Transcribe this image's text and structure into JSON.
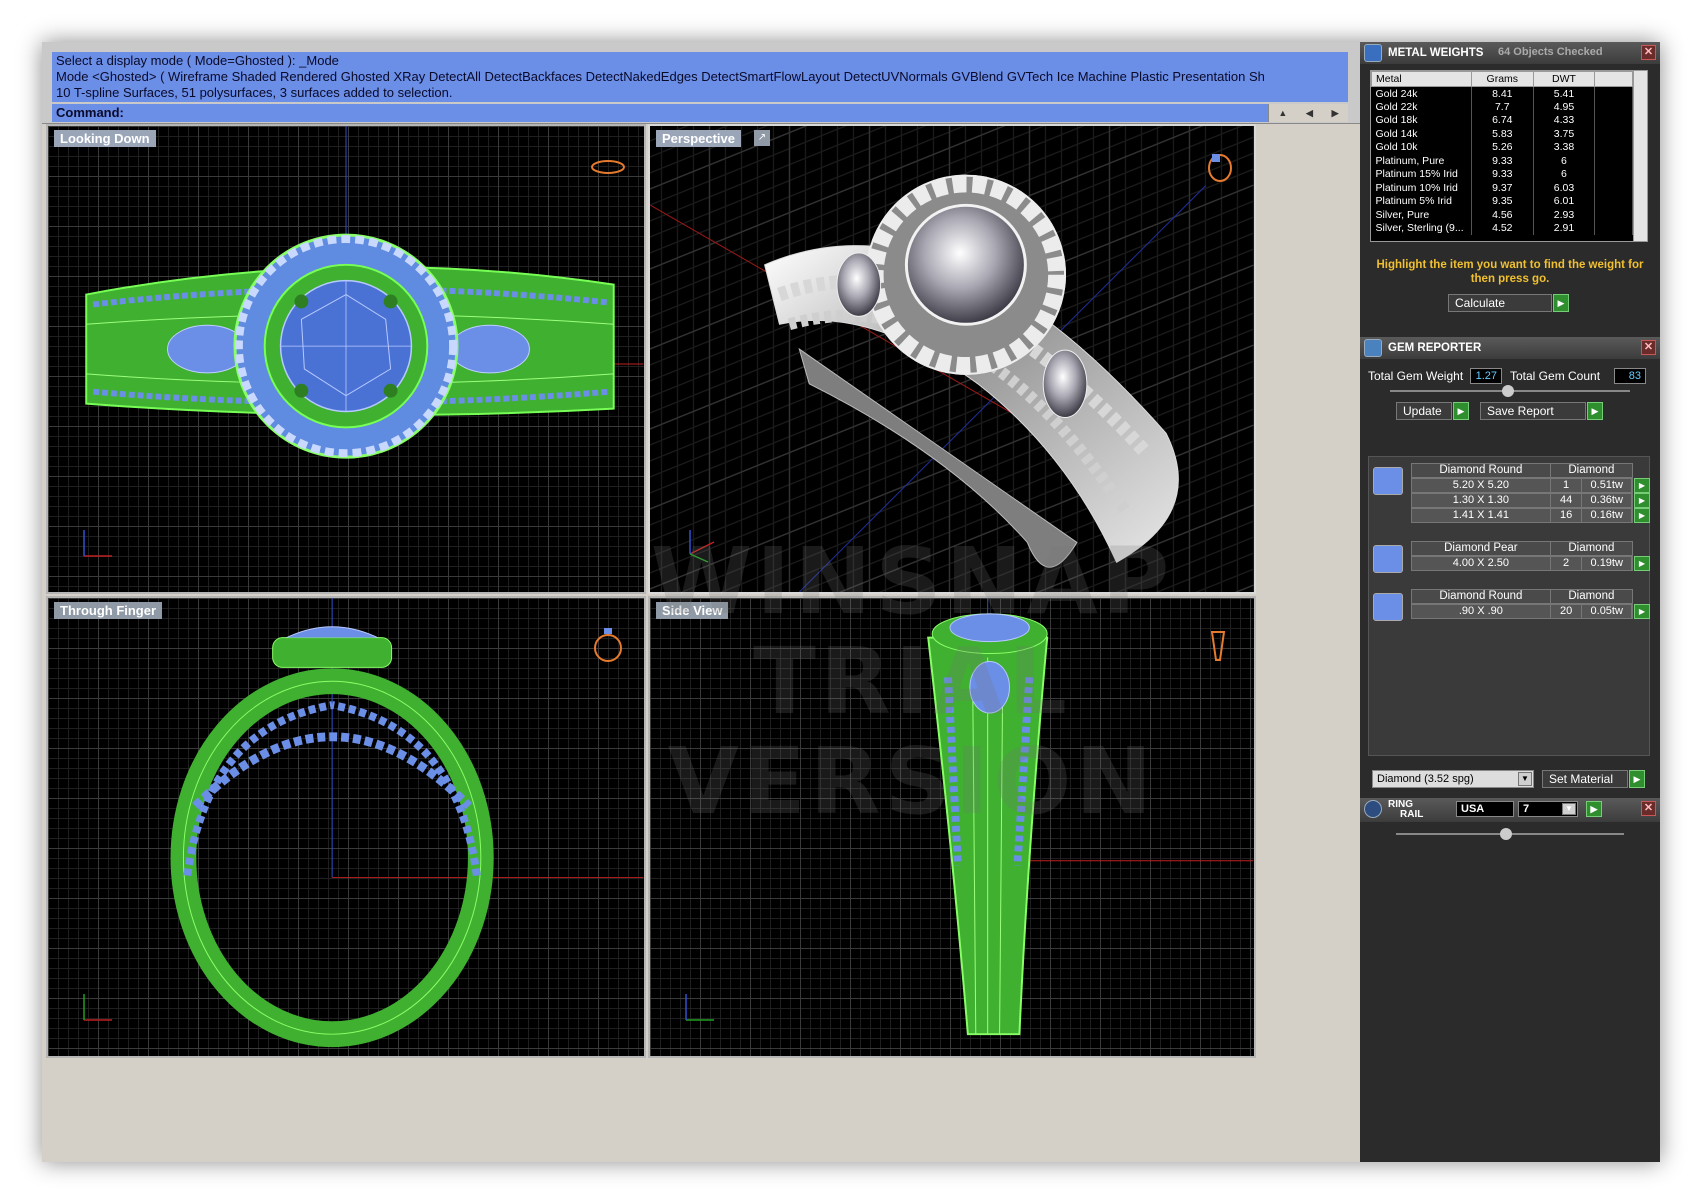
{
  "command": {
    "history": [
      "Select a display mode ( Mode=Ghosted ): _Mode",
      "Mode <Ghosted> ( Wireframe  Shaded  Rendered  Ghosted  XRay  DetectAll  DetectBackfaces  DetectNakedEdges  DetectSmartFlowLayout  DetectUVNormals  GVBlend  GVTech  Ice  Machine  Plastic  Presentation  Sh",
      "10 T-spline Surfaces, 51 polysurfaces, 3 surfaces added to selection."
    ],
    "prompt": "Command:"
  },
  "viewports": {
    "top_left": "Looking Down",
    "top_right": "Perspective",
    "bottom_left": "Through Finger",
    "bottom_right": "Side View"
  },
  "axis_labels": {
    "tl": [
      "y",
      "x"
    ],
    "tr": [
      "z",
      "x",
      "y"
    ],
    "bl": [
      "z",
      "x"
    ],
    "br": [
      "z",
      "y"
    ]
  },
  "watermark": {
    "line1": "WINSNAP",
    "line2": "TRIAL VERSION"
  },
  "metal_weights": {
    "title": "METAL WEIGHTS",
    "status": "64 Objects Checked",
    "columns": [
      "Metal",
      "Grams",
      "DWT"
    ],
    "rows": [
      [
        "Gold 24k",
        "8.41",
        "5.41"
      ],
      [
        "Gold 22k",
        "7.7",
        "4.95"
      ],
      [
        "Gold 18k",
        "6.74",
        "4.33"
      ],
      [
        "Gold 14k",
        "5.83",
        "3.75"
      ],
      [
        "Gold 10k",
        "5.26",
        "3.38"
      ],
      [
        "Platinum, Pure",
        "9.33",
        "6"
      ],
      [
        "Platinum 15% Irid",
        "9.33",
        "6"
      ],
      [
        "Platinum 10% Irid",
        "9.37",
        "6.03"
      ],
      [
        "Platinum 5% Irid",
        "9.35",
        "6.01"
      ],
      [
        "Silver, Pure",
        "4.56",
        "2.93"
      ],
      [
        "Silver, Sterling (9...",
        "4.52",
        "2.91"
      ]
    ],
    "hint": "Highlight the item you want to find the weight for then press go.",
    "calculate_label": "Calculate"
  },
  "gem_reporter": {
    "title": "GEM REPORTER",
    "total_weight_label": "Total Gem Weight",
    "total_weight": "1.27",
    "total_count_label": "Total Gem Count",
    "total_count": "83",
    "update_label": "Update",
    "save_label": "Save Report",
    "groups": [
      {
        "shape": "Diamond Round",
        "material": "Diamond",
        "rows": [
          [
            "5.20 X 5.20",
            "1",
            "0.51tw"
          ],
          [
            "1.30 X 1.30",
            "44",
            "0.36tw"
          ],
          [
            "1.41 X 1.41",
            "16",
            "0.16tw"
          ]
        ]
      },
      {
        "shape": "Diamond Pear",
        "material": "Diamond",
        "rows": [
          [
            "4.00 X 2.50",
            "2",
            "0.19tw"
          ]
        ]
      },
      {
        "shape": "Diamond Round",
        "material": "Diamond",
        "rows": [
          [
            ".90 X .90",
            "20",
            "0.05tw"
          ]
        ]
      }
    ],
    "material_select": "Diamond    (3.52 spg)",
    "set_material_label": "Set Material"
  },
  "ring_rail": {
    "title_line1": "RING",
    "title_line2": "RAIL",
    "region": "USA",
    "size": "7"
  },
  "colors": {
    "wire_green": "#55ee44",
    "gem_blue": "#6b8ee6",
    "command_bg": "#6b8ee6",
    "hint_text": "#f0c030",
    "panel_bg": "#2b2b2b"
  }
}
